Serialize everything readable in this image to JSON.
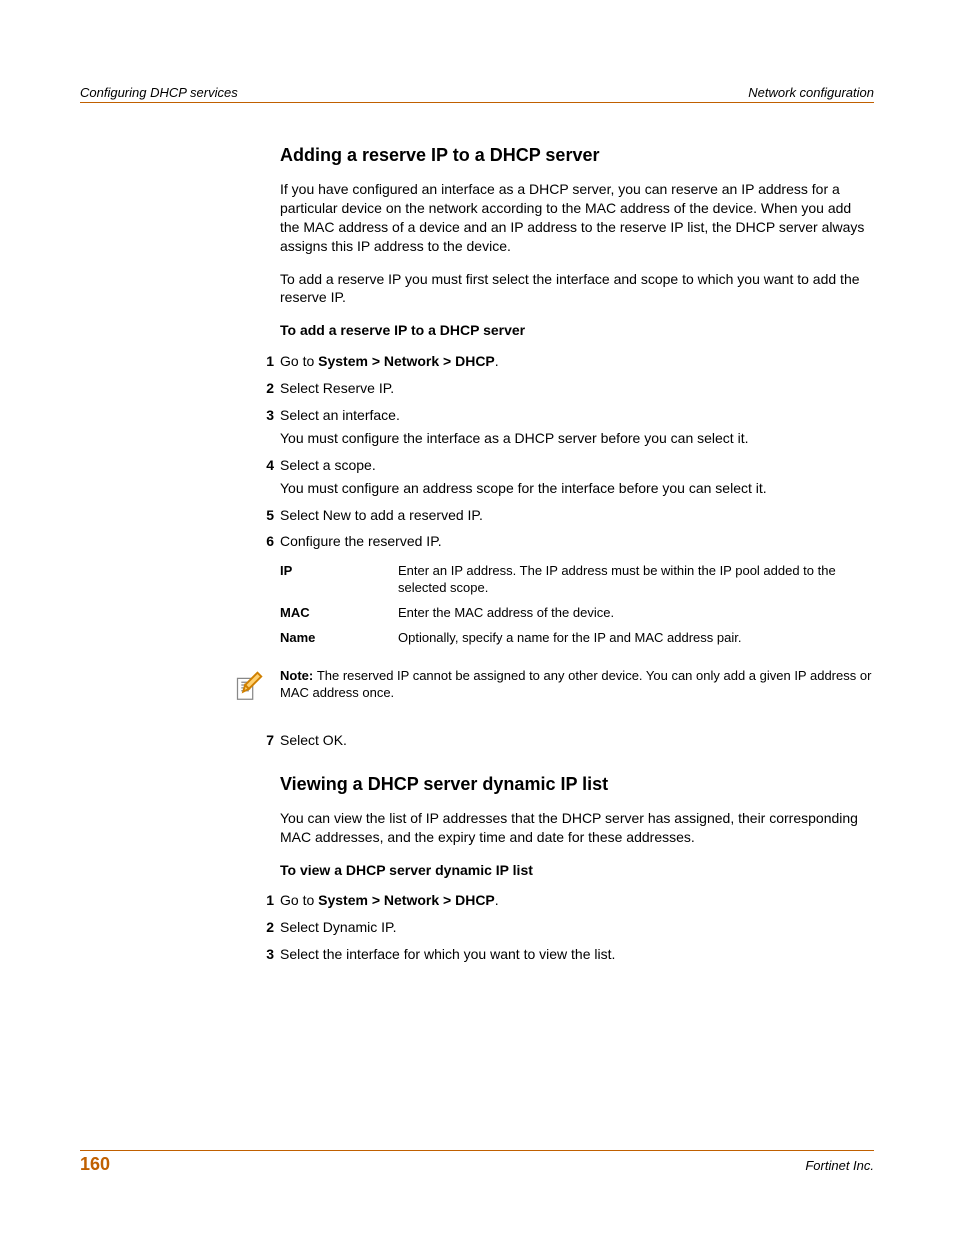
{
  "header": {
    "left": "Configuring DHCP services",
    "right": "Network configuration"
  },
  "section1": {
    "title": "Adding a reserve IP to a DHCP server",
    "p1": "If you have configured an interface as a DHCP server, you can reserve an IP address for a particular device on the network according to the MAC address of the device. When you add the MAC address of a device and an IP address to the reserve IP list, the DHCP server always assigns this IP address to the device.",
    "p2": "To add a reserve IP you must first select the interface and scope to which you want to add the reserve IP.",
    "subhead": "To add a reserve IP to a DHCP server",
    "steps": {
      "s1a": "Go to ",
      "s1b": "System > Network > DHCP",
      "s1c": ".",
      "s2": "Select Reserve IP.",
      "s3a": "Select an interface.",
      "s3b": "You must configure the interface as a DHCP server before you can select it.",
      "s4a": "Select a scope.",
      "s4b": "You must configure an address scope for the interface before you can select it.",
      "s5": "Select New to add a reserved IP.",
      "s6": "Configure the reserved IP.",
      "s7": "Select OK."
    },
    "defs": {
      "ip_k": "IP",
      "ip_v": "Enter an IP address. The IP address must be within the IP pool added to the selected scope.",
      "mac_k": "MAC",
      "mac_v": "Enter the MAC address of the device.",
      "name_k": "Name",
      "name_v": "Optionally, specify a name for the IP and MAC address pair."
    },
    "note_label": "Note: ",
    "note": "The reserved IP cannot be assigned to any other device. You can only add a given IP address or MAC address once."
  },
  "section2": {
    "title": "Viewing a DHCP server dynamic IP list",
    "p1": "You can view the list of IP addresses that the DHCP server has assigned, their corresponding MAC addresses, and the expiry time and date for these addresses.",
    "subhead": "To view a DHCP server dynamic IP list",
    "steps": {
      "s1a": "Go to ",
      "s1b": "System > Network > DHCP",
      "s1c": ".",
      "s2": "Select Dynamic IP.",
      "s3": "Select the interface for which you want to view the list."
    }
  },
  "footer": {
    "page": "160",
    "company": "Fortinet Inc."
  }
}
